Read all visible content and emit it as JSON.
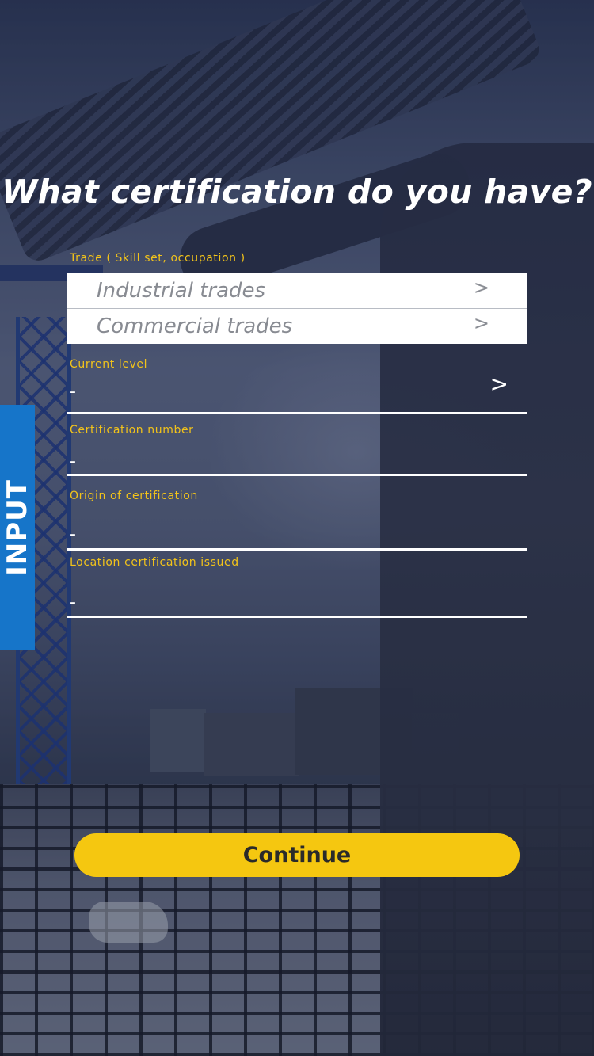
{
  "page": {
    "title": "What certification do you have?",
    "side_tab_label": "INPUT"
  },
  "trade": {
    "label": "Trade ( Skill set, occupation )",
    "options": [
      {
        "label": "Industrial trades",
        "chevron": ">"
      },
      {
        "label": "Commercial trades",
        "chevron": ">"
      }
    ]
  },
  "fields": {
    "current_level": {
      "label": "Current level",
      "value": "-",
      "chevron": ">"
    },
    "certification_number": {
      "label": "Certification number",
      "value": "-"
    },
    "origin": {
      "label": "Origin of certification",
      "value": "-"
    },
    "location": {
      "label": "Location certification issued",
      "value": "-"
    }
  },
  "actions": {
    "continue_label": "Continue"
  },
  "colors": {
    "accent_yellow": "#f5c710",
    "label_yellow": "#f2c31a",
    "side_tab_blue": "#1675c9",
    "text_white": "#ffffff"
  }
}
